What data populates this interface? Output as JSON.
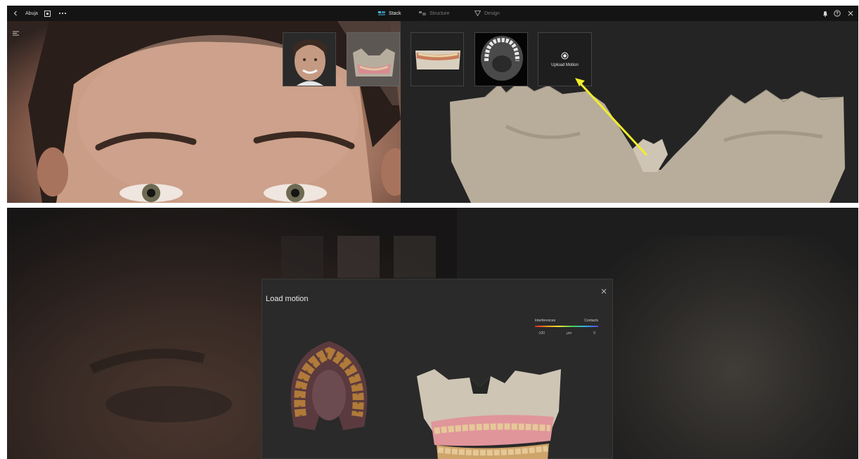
{
  "app": {
    "back_icon": "chevron-left-icon",
    "project_name": "Abuja",
    "tabs": [
      {
        "label": "Stack",
        "icon": "stack-icon",
        "active": true
      },
      {
        "label": "Structure",
        "icon": "structure-icon",
        "active": false
      },
      {
        "label": "Design",
        "icon": "design-icon",
        "active": false
      }
    ],
    "right_icons": [
      "bell-icon",
      "help-icon",
      "close-icon"
    ]
  },
  "stack": {
    "thumbnails": [
      "face-photo",
      "jaw-scan-overlay",
      "dentition-scan",
      "ct-slice"
    ],
    "upload_label": "Upload Motion"
  },
  "modal": {
    "title": "Load motion",
    "legend": {
      "left_label": "Interferences",
      "right_label": "Contacts",
      "scale_min": "-100",
      "scale_unit": "µm",
      "scale_max": "0"
    }
  },
  "colors": {
    "topbar": "#141414",
    "accent_stack": "#3fb6e8",
    "arrow": "#f2ee2c",
    "scan_bone": "#b8ad9b",
    "gum": "#d88c93",
    "tooth_gold": "#b07a3a"
  }
}
